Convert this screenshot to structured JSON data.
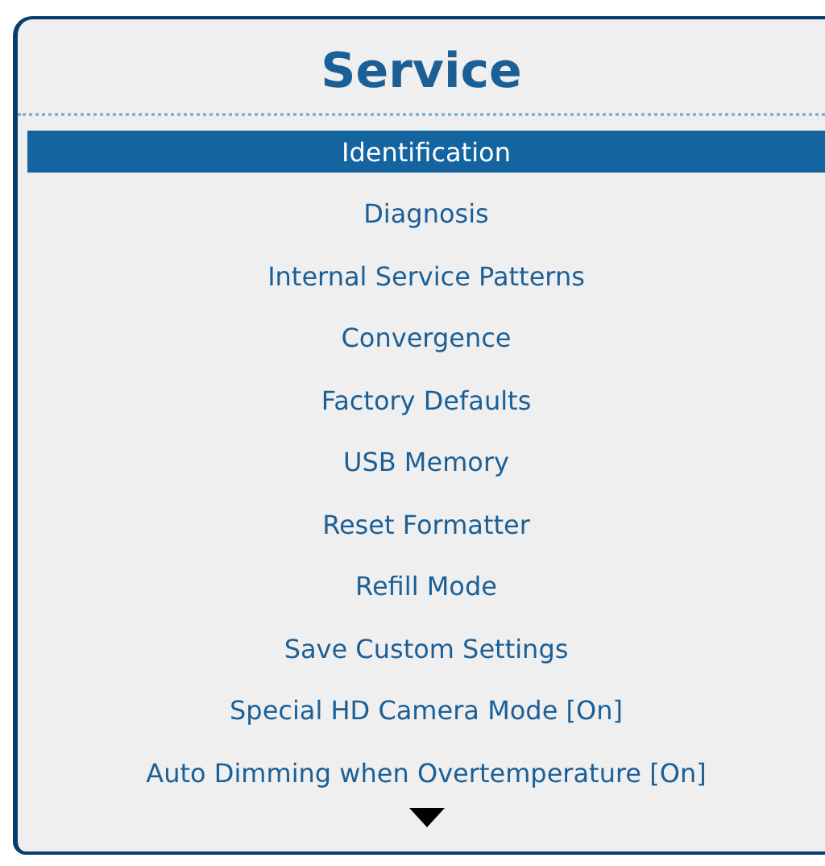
{
  "title": "Service",
  "items": [
    {
      "label": "Identification",
      "selected": true
    },
    {
      "label": "Diagnosis",
      "selected": false
    },
    {
      "label": "Internal Service Patterns",
      "selected": false
    },
    {
      "label": "Convergence",
      "selected": false
    },
    {
      "label": "Factory Defaults",
      "selected": false
    },
    {
      "label": "USB Memory",
      "selected": false
    },
    {
      "label": "Reset Formatter",
      "selected": false
    },
    {
      "label": "Refill Mode",
      "selected": false
    },
    {
      "label": "Save Custom Settings",
      "selected": false
    },
    {
      "label": "Special HD Camera Mode [On]",
      "selected": false
    },
    {
      "label": "Auto Dimming when Overtemperature [On]",
      "selected": false
    }
  ]
}
